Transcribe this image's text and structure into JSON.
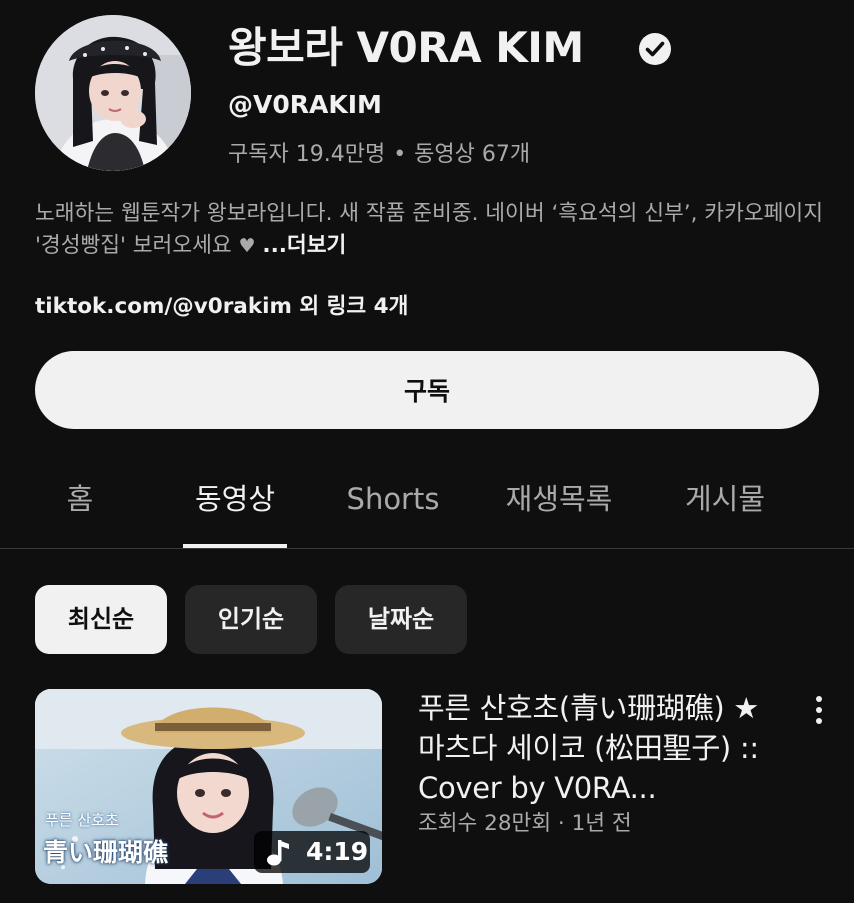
{
  "channel": {
    "name": "왕보라 V0RA KIM",
    "handle": "@V0RAKIM",
    "subscribers": "구독자 19.4만명",
    "stats_separator": "•",
    "video_count": "동영상 67개",
    "description": "노래하는 웹툰작가 왕보라입니다. 새 작품 준비중. 네이버 ‘흑요석의 신부’, 카카오페이지 '경성빵집' 보러오세요",
    "description_heart": "♥",
    "more_label": "...더보기",
    "links": "tiktok.com/@v0rakim 외 링크 4개"
  },
  "subscribe_label": "구독",
  "tabs": [
    {
      "label": "홈",
      "active": false
    },
    {
      "label": "동영상",
      "active": true
    },
    {
      "label": "Shorts",
      "active": false
    },
    {
      "label": "재생목록",
      "active": false
    },
    {
      "label": "게시물",
      "active": false
    }
  ],
  "filters": [
    {
      "label": "최신순",
      "selected": true
    },
    {
      "label": "인기순",
      "selected": false
    },
    {
      "label": "날짜순",
      "selected": false
    }
  ],
  "video": {
    "title": "푸른 산호초(青い珊瑚礁) ★ 마츠다 세이코 (松田聖子) :: Cover by V0RA...",
    "meta": "조회수 28만회 · 1년 전",
    "duration": "4:19",
    "thumbnail_subtitle": "푸른 산호초",
    "thumbnail_title": "青い珊瑚礁"
  },
  "icons": {
    "verified": "verified-badge-icon",
    "music_note": "music-note-icon",
    "menu": "more-vertical-icon"
  },
  "colors": {
    "background": "#0f0f0f",
    "text_primary": "#f1f1f1",
    "text_secondary": "#aaaaaa",
    "chip_bg": "#272727",
    "button_bg": "#f1f1f1"
  }
}
